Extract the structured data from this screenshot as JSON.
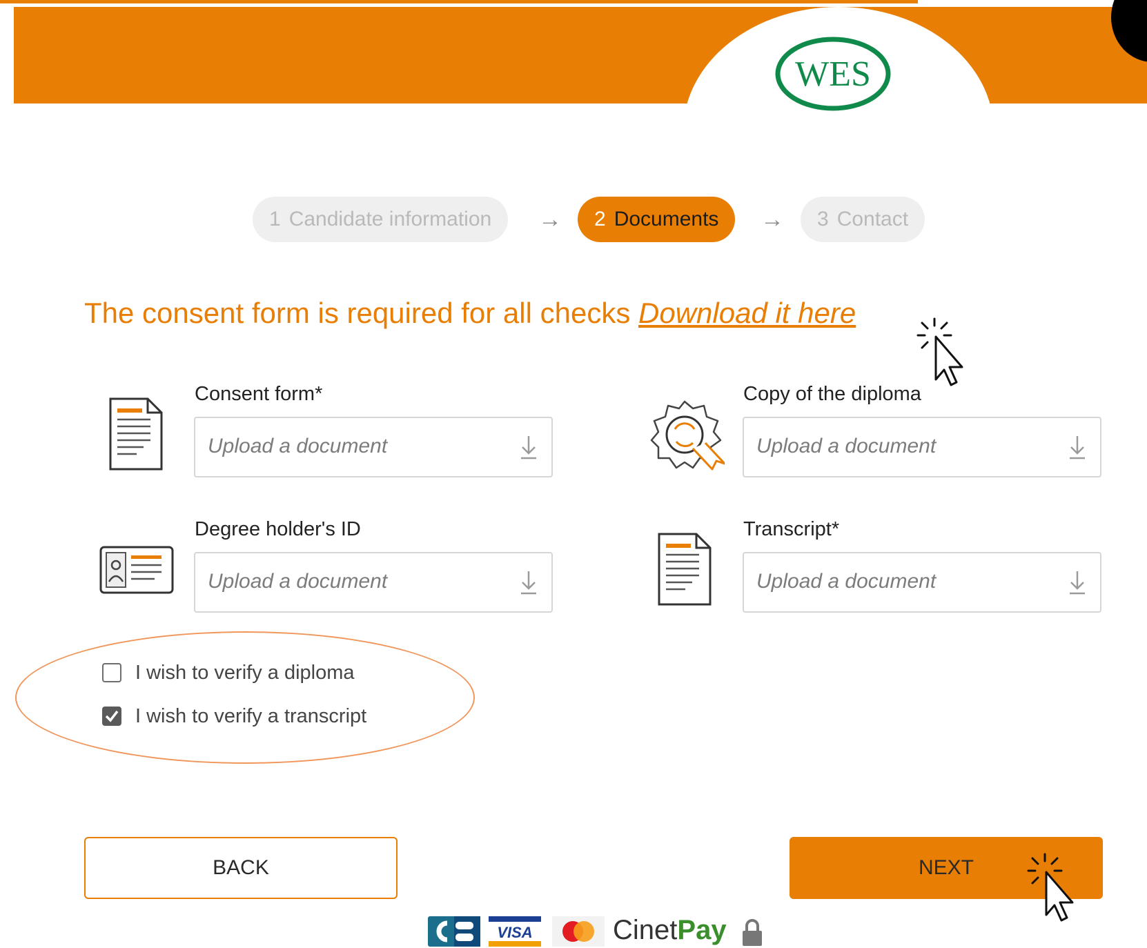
{
  "header": {
    "logo_text": "WES",
    "colors": {
      "brand_orange": "#e87e04",
      "logo_green": "#0f8a4a"
    }
  },
  "stepper": {
    "steps": [
      {
        "number": "1",
        "label": "Candidate information",
        "state": "inactive"
      },
      {
        "number": "2",
        "label": "Documents",
        "state": "active"
      },
      {
        "number": "3",
        "label": "Contact",
        "state": "inactive"
      }
    ],
    "separator": "→"
  },
  "consent": {
    "text": "The consent form is required for all checks ",
    "link_label": "Download it here"
  },
  "uploads": [
    {
      "label": "Consent form*",
      "placeholder": "Upload a document",
      "icon": "document-icon"
    },
    {
      "label": "Copy of the diploma",
      "placeholder": "Upload a document",
      "icon": "certificate-icon"
    },
    {
      "label": "Degree holder's ID",
      "placeholder": "Upload a document",
      "icon": "id-card-icon"
    },
    {
      "label": "Transcript*",
      "placeholder": "Upload a document",
      "icon": "document-icon"
    }
  ],
  "options": [
    {
      "label": "I wish to verify a diploma",
      "checked": false
    },
    {
      "label": "I wish to verify a transcript",
      "checked": true
    }
  ],
  "buttons": {
    "back": "BACK",
    "next": "NEXT"
  },
  "payment": {
    "cinet": "Cinet",
    "pay": "Pay",
    "methods": [
      "CB",
      "VISA",
      "Mastercard"
    ]
  }
}
